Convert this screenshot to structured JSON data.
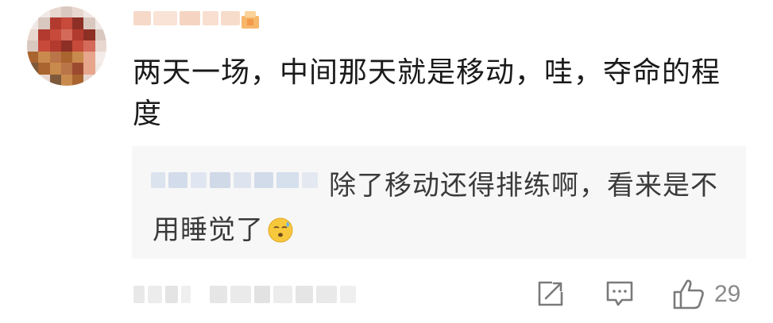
{
  "comment": {
    "author_blurred": true,
    "text": "两天一场，中间那天就是移动，哇，夺命的程度"
  },
  "reply": {
    "author_blurred": true,
    "text": "除了移动还得排练啊，看来是不用睡觉了",
    "emoji": "sweat-face-emoji"
  },
  "footer": {
    "meta_blurred": true,
    "like_count": "29"
  },
  "icons": {
    "share": "share-icon",
    "comment": "comment-icon",
    "like": "thumbs-up-icon",
    "vip": "vip-crown-badge"
  },
  "colors": {
    "reply_bg": "#f7f7f7",
    "icon": "#7a7a7a",
    "text": "#1a1a1a"
  }
}
